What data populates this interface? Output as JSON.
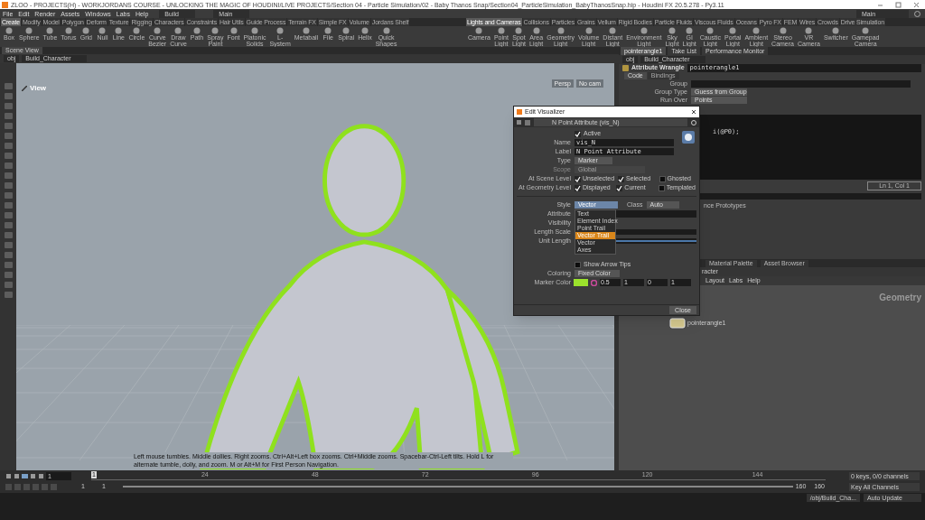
{
  "window": {
    "title": "ZLOO - PROJECTS(H) - WORKJORDANS COURSE - UNLOCKING THE MAGIC OF HOUDINI/LIVE PROJECTS/Section 04 - Particle Simulation/02 - Baby Thanos Snap/Section04_ParticleSimulation_BabyThanosSnap.hip - Houdini FX 20.5.278 - Py3.11"
  },
  "menu": [
    "File",
    "Edit",
    "Render",
    "Assets",
    "Windows",
    "Labs",
    "Help"
  ],
  "desktops": [
    "Build",
    "Main",
    "Main"
  ],
  "shelf_left": {
    "tabs": [
      {
        "label": "Create",
        "selected": true
      },
      {
        "label": "Modify",
        "selected": false
      },
      {
        "label": "Model",
        "selected": false
      },
      {
        "label": "Polygon",
        "selected": false
      },
      {
        "label": "Deform",
        "selected": false
      },
      {
        "label": "Texture",
        "selected": false
      },
      {
        "label": "Rigging",
        "selected": false
      },
      {
        "label": "Characters",
        "selected": false
      },
      {
        "label": "Constraints",
        "selected": false
      },
      {
        "label": "Hair Utils",
        "selected": false
      },
      {
        "label": "Guide Process",
        "selected": false
      },
      {
        "label": "Terrain FX",
        "selected": false
      },
      {
        "label": "Simple FX",
        "selected": false
      },
      {
        "label": "Volume",
        "selected": false
      },
      {
        "label": "Jordans Shelf",
        "selected": false
      }
    ],
    "tools": [
      "Box",
      "Sphere",
      "Tube",
      "Torus",
      "Grid",
      "Null",
      "Line",
      "Circle",
      "Curve Bezier",
      "Draw Curve",
      "Path",
      "Spray Paint",
      "Font",
      "Platonic Solids",
      "L-System",
      "Metaball",
      "File",
      "Spiral",
      "Helix",
      "Quick Shapes"
    ]
  },
  "shelf_right": {
    "tabs": [
      {
        "label": "Lights and Cameras",
        "selected": true
      },
      {
        "label": "Collisions",
        "selected": false
      },
      {
        "label": "Particles",
        "selected": false
      },
      {
        "label": "Grains",
        "selected": false
      },
      {
        "label": "Vellum",
        "selected": false
      },
      {
        "label": "Rigid Bodies",
        "selected": false
      },
      {
        "label": "Particle Fluids",
        "selected": false
      },
      {
        "label": "Viscous Fluids",
        "selected": false
      },
      {
        "label": "Oceans",
        "selected": false
      },
      {
        "label": "Pyro FX",
        "selected": false
      },
      {
        "label": "FEM",
        "selected": false
      },
      {
        "label": "Wires",
        "selected": false
      },
      {
        "label": "Crowds",
        "selected": false
      },
      {
        "label": "Drive Simulation",
        "selected": false
      }
    ],
    "tools": [
      "Camera",
      "Point Light",
      "Spot Light",
      "Area Light",
      "Geometry Light",
      "Volume Light",
      "Distant Light",
      "Environment Light",
      "Sky Light",
      "GI Light",
      "Caustic Light",
      "Portal Light",
      "Ambient Light",
      "Stereo Camera",
      "VR Camera",
      "Switcher",
      "Gamepad Camera"
    ]
  },
  "scene_view": {
    "tab": "Scene View",
    "path": [
      "obj",
      "Build_Character"
    ],
    "label": "View",
    "menus": [
      "Persp",
      "No cam"
    ],
    "hint": "Left mouse tumbles. Middle dollies. Right zooms. Ctrl+Alt+Left box zooms. Ctrl+Middle zooms. Spacebar-Ctrl-Left tilts. Hold L for alternate tumble, dolly, and zoom. M or Alt+M for First Person Navigation."
  },
  "parameters": {
    "tabs": [
      {
        "label": "pointerangle1",
        "selected": true
      },
      {
        "label": "Take List",
        "selected": false
      },
      {
        "label": "Performance Monitor",
        "selected": false
      }
    ],
    "path": [
      "obj",
      "Build_Character"
    ],
    "node_type": "Attribute Wrangle",
    "node_name": "pointerangle1",
    "subtabs": [
      {
        "label": "Code",
        "selected": true
      },
      {
        "label": "Bindings",
        "selected": false
      }
    ],
    "fields": [
      {
        "label": "Group"
      },
      {
        "label": "Group Type",
        "value": "Guess from Group"
      },
      {
        "label": "Run Over",
        "value": "Points"
      }
    ],
    "code": "i(@P0);",
    "cursor": "Ln 1, Col 1",
    "partial_label": "nce Prototypes"
  },
  "network": {
    "tabs": [
      "Material Palette",
      "Asset Browser"
    ],
    "path": "racter",
    "menu": [
      "Layout",
      "Labs",
      "Help"
    ],
    "context": "Geometry",
    "node": "pointerangle1"
  },
  "visualizer": {
    "title": "Edit Visualizer",
    "header": "N Point Attribute (vis_N)",
    "active": {
      "label": "Active",
      "checked": true
    },
    "name_label": "Name",
    "name": "vis_N",
    "label_label": "Label",
    "label": "N Point Attribute",
    "type_label": "Type",
    "type": "Marker",
    "scope_label": "Scope",
    "scope": "Global",
    "scene_level": {
      "label": "At Scene Level",
      "options": [
        {
          "label": "Unselected",
          "checked": true
        },
        {
          "label": "Selected",
          "checked": true
        },
        {
          "label": "Ghosted",
          "checked": false
        }
      ]
    },
    "geometry_level": {
      "label": "At Geometry Level",
      "options": [
        {
          "label": "Displayed",
          "checked": true
        },
        {
          "label": "Current",
          "checked": true
        },
        {
          "label": "Templated",
          "checked": false
        }
      ]
    },
    "style_label": "Style",
    "style": "Vector",
    "class_label": "Class",
    "class": "Auto",
    "style_options": [
      {
        "label": "Text",
        "selected": false
      },
      {
        "label": "Element Index",
        "selected": false
      },
      {
        "label": "Point Trail",
        "selected": false
      },
      {
        "label": "Vector Trail",
        "selected": true
      },
      {
        "label": "Vector",
        "selected": false
      },
      {
        "label": "Axes",
        "selected": false
      }
    ],
    "attribute_label": "Attribute",
    "visibility_label": "Visibility",
    "length_scale_label": "Length Scale",
    "unit_length_label": "Unit Length",
    "length_scale": {
      "level": 0
    },
    "unit_length": {
      "level": 1
    },
    "arrow_tips": {
      "label": "Show Arrow Tips",
      "checked": false
    },
    "coloring_label": "Coloring",
    "coloring": "Fixed Color",
    "marker_color_label": "Marker Color",
    "marker_color": {
      "color": "#9be22c",
      "values": [
        "0.5",
        "1",
        "0",
        "1"
      ]
    },
    "close": "Close"
  },
  "timeline": {
    "frame": "1",
    "key": "1",
    "ticks": [
      "24",
      "48",
      "72",
      "96",
      "120",
      "144"
    ],
    "start": [
      "1",
      "1"
    ],
    "end": [
      "160",
      "160"
    ],
    "keys": "0 keys, 0/0 channels",
    "key_all": "Key All Channels"
  },
  "status": {
    "path": "/obj/Build_Cha...",
    "update": "Auto Update"
  }
}
